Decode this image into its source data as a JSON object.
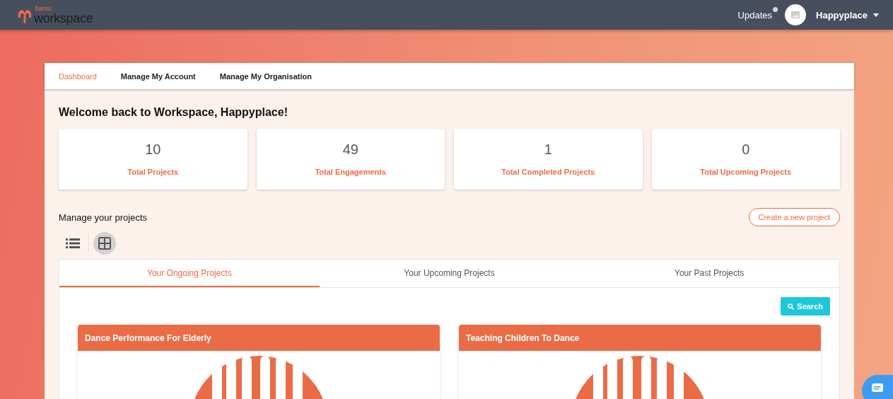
{
  "header": {
    "logo_small": "bantu",
    "logo_main": "workspace",
    "updates": "Updates",
    "updates_unread": true,
    "user": "Happyplace"
  },
  "nav": [
    {
      "label": "Dashboard",
      "selected": true
    },
    {
      "label": "Manage My Account",
      "selected": false
    },
    {
      "label": "Manage My Organisation",
      "selected": false
    }
  ],
  "welcome": "Welcome back to Workspace, Happyplace!",
  "stats": [
    {
      "value": "10",
      "label": "Total Projects"
    },
    {
      "value": "49",
      "label": "Total Engagements"
    },
    {
      "value": "1",
      "label": "Total Completed Projects"
    },
    {
      "value": "0",
      "label": "Total Upcoming Projects"
    }
  ],
  "projects_heading": "Manage your projects",
  "create_button": "Create a new project",
  "views": [
    {
      "kind": "list",
      "selected": false
    },
    {
      "kind": "grid",
      "selected": true
    }
  ],
  "tabs": [
    {
      "label": "Your Ongoing Projects",
      "selected": true
    },
    {
      "label": "Your Upcoming Projects",
      "selected": false
    },
    {
      "label": "Your Past Projects",
      "selected": false
    }
  ],
  "search_button": "Search",
  "projects": [
    {
      "title": "Dance Performance For Elderly"
    },
    {
      "title": "Teaching Children To Dance"
    }
  ]
}
